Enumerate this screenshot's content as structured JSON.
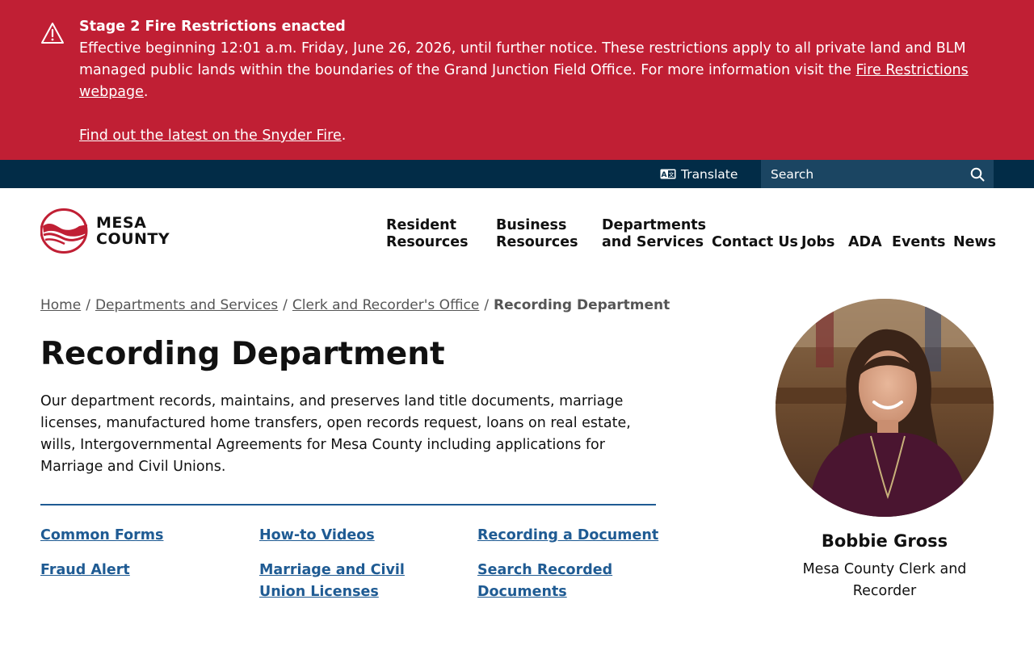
{
  "alert": {
    "title": "Stage 2 Fire Restrictions enacted",
    "body": "Effective beginning 12:01 a.m. Friday, June 26, 2026, until further notice. These restrictions apply to all private land and BLM managed public lands within the boundaries of the Grand Junction Field Office. For more information visit the ",
    "link_label": "Fire Restrictions webpage",
    "body_end": ".",
    "snyder_link": "Find out the latest on the Snyder Fire",
    "snyder_end": ".",
    "icon": "warning-icon"
  },
  "utility": {
    "translate_label": "Translate",
    "search_placeholder": "Search"
  },
  "logo": {
    "line1": "MESA",
    "line2": "COUNTY"
  },
  "nav": {
    "resident_1": "Resident",
    "resident_2": "Resources",
    "business_1": "Business",
    "business_2": "Resources",
    "departments_1": "Departments",
    "departments_2": "and Services",
    "contact": "Contact Us",
    "jobs": "Jobs",
    "ada": "ADA",
    "events": "Events",
    "news": "News"
  },
  "breadcrumb": {
    "home": "Home",
    "departments": "Departments and Services",
    "clerk": "Clerk and Recorder's Office",
    "current": "Recording Department",
    "sep": "/"
  },
  "page": {
    "title": "Recording Department",
    "intro": "Our department records, maintains, and preserves land title documents, marriage licenses, manufactured home transfers, open records request, loans on real estate, wills, Intergovernmental Agreements for Mesa County including applications for Marriage and Civil Unions."
  },
  "links": {
    "common_forms": "Common Forms",
    "how_to_videos": "How-to Videos",
    "recording_document": "Recording a Document",
    "fraud_alert": "Fraud Alert",
    "marriage_licenses": "Marriage and Civil Union Licenses",
    "search_recorded": "Search Recorded Documents"
  },
  "profile": {
    "name": "Bobbie Gross",
    "role": "Mesa County Clerk and Recorder"
  },
  "colors": {
    "alert_red": "#c01f34",
    "utility_navy": "#022c47",
    "search_bg": "#1b4562",
    "link_blue": "#1f5b93"
  }
}
